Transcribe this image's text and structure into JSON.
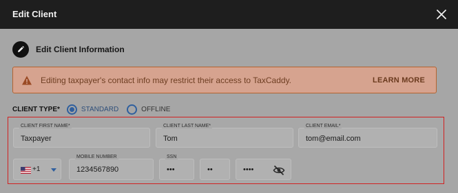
{
  "dialog": {
    "title": "Edit Client"
  },
  "section": {
    "title": "Edit Client Information"
  },
  "warning": {
    "message": "Editing taxpayer's contact info may restrict their access to TaxCaddy.",
    "link": "LEARN MORE"
  },
  "client_type": {
    "label": "CLIENT TYPE*",
    "options": [
      {
        "label": "STANDARD",
        "selected": true
      },
      {
        "label": "OFFLINE",
        "selected": false
      }
    ]
  },
  "fields": {
    "first_name": {
      "label": "CLIENT FIRST NAME*",
      "value": "Taxpayer"
    },
    "last_name": {
      "label": "CLIENT LAST NAME*",
      "value": "Tom"
    },
    "email": {
      "label": "CLIENT EMAIL*",
      "value": "tom@email.com"
    },
    "country_code": {
      "value": "+1",
      "flag": "us-flag-icon"
    },
    "mobile": {
      "label": "MOBILE NUMBER",
      "value": "1234567890"
    },
    "ssn": {
      "label": "SSN",
      "part1": "•••",
      "part2": "••",
      "part3": "••••"
    }
  },
  "colors": {
    "accent": "#2f5f9e",
    "warning_bg": "#d6a38f",
    "warning_border": "#b4632f",
    "error_outline": "#d12020"
  }
}
